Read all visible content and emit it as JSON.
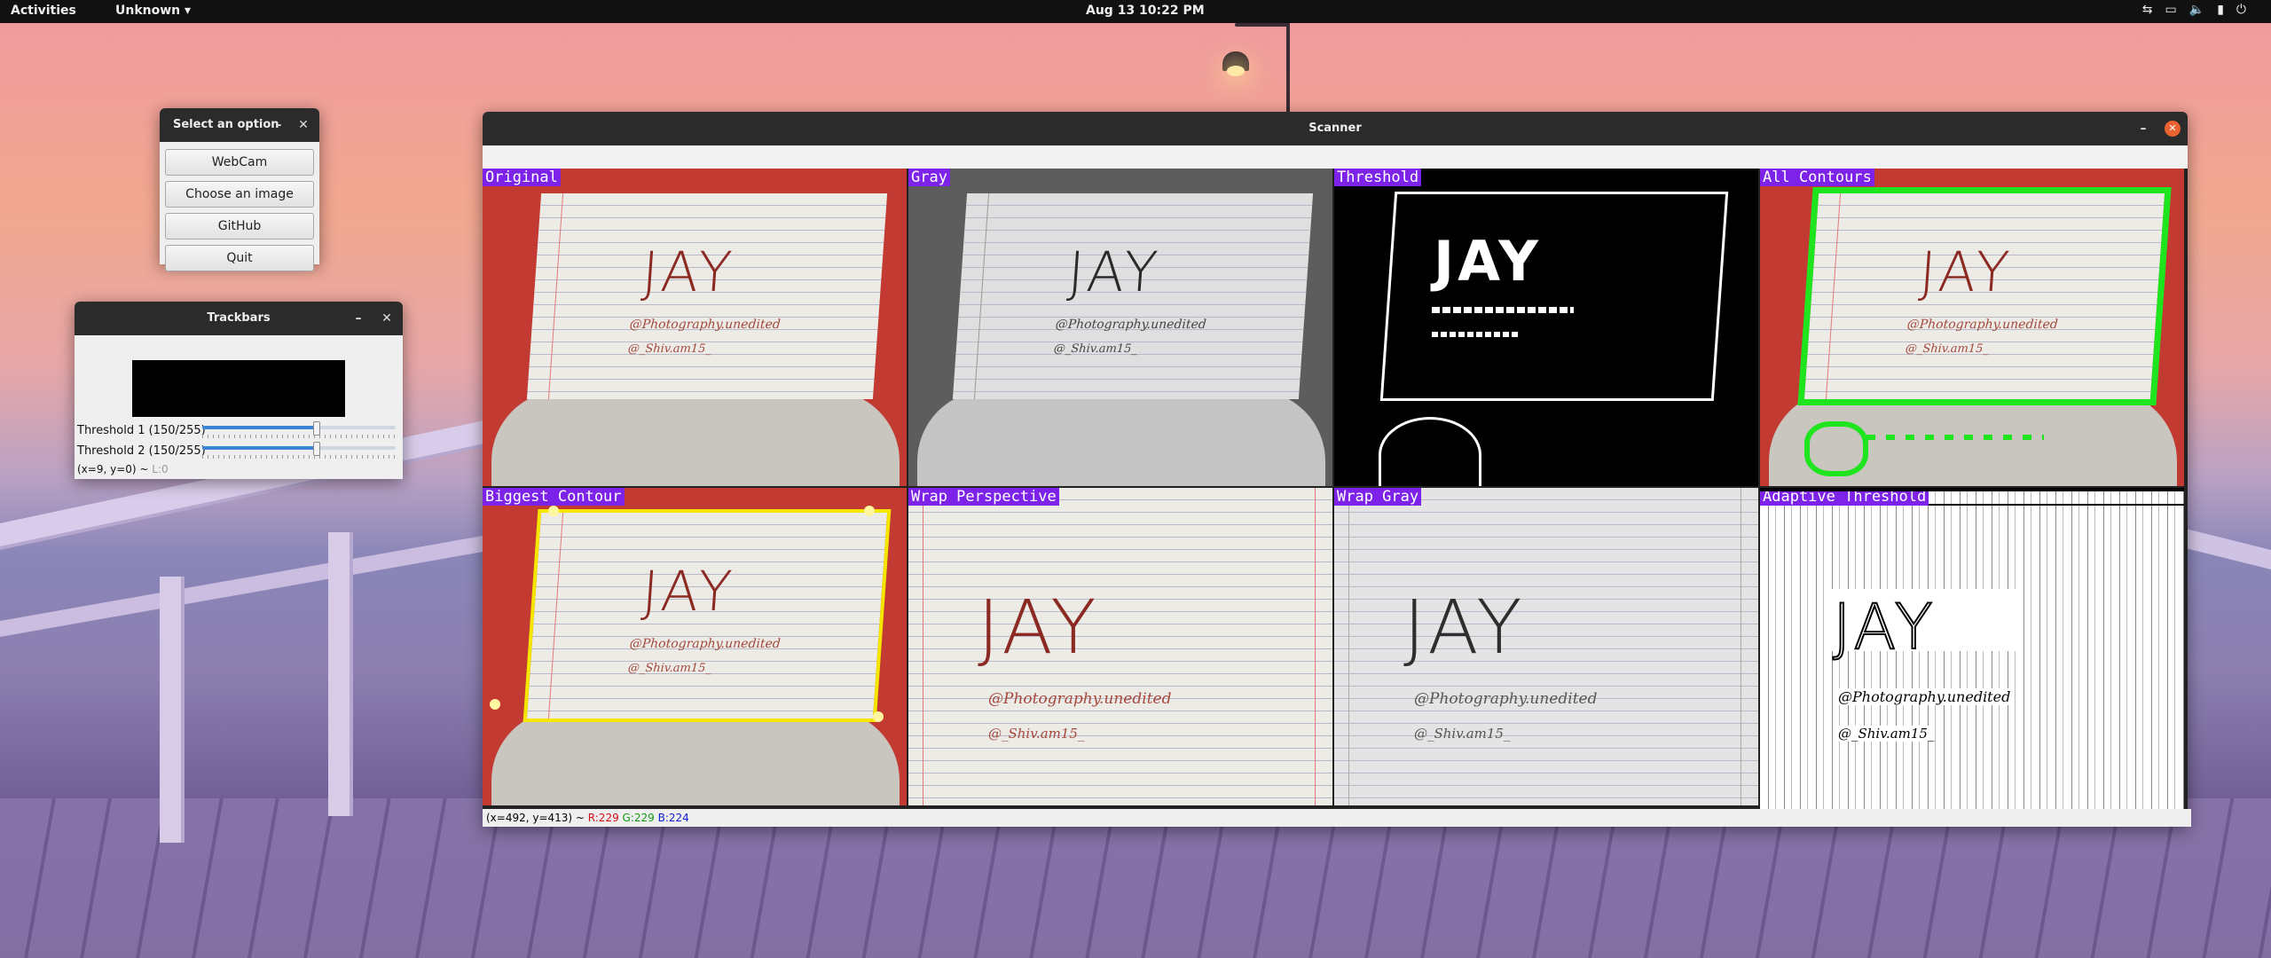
{
  "topbar": {
    "activities": "Activities",
    "app_menu": "Unknown ▾",
    "clock": "Aug 13  10:22 PM"
  },
  "option_window": {
    "title": "Select an option",
    "buttons": [
      "WebCam",
      "Choose an image",
      "GitHub",
      "Quit"
    ]
  },
  "trackbars_window": {
    "title": "Trackbars",
    "threshold1_label": "Threshold 1 (150/255)",
    "threshold2_label": "Threshold 2 (150/255)",
    "threshold1_value": 150,
    "threshold2_value": 150,
    "max": 255,
    "status": "(x=9, y=0) ~ ",
    "status_l": "L:0"
  },
  "scanner_window": {
    "title": "Scanner",
    "panels": [
      {
        "label": "Original"
      },
      {
        "label": "Gray"
      },
      {
        "label": "Threshold"
      },
      {
        "label": "All Contours"
      },
      {
        "label": "Biggest Contour"
      },
      {
        "label": "Wrap Perspective"
      },
      {
        "label": "Wrap Gray"
      },
      {
        "label": "Adaptive Threshold"
      }
    ],
    "paper_text": "JAY",
    "paper_line1": "@Photography.unedited",
    "paper_line2": "@_Shiv.am15_",
    "status_coords": "(x=492, y=413) ~ ",
    "status_r": "R:229",
    "status_g": "G:229",
    "status_b": "B:224"
  },
  "colors": {
    "label_bg": "#7d22e8",
    "contour_green": "#1ee51e",
    "contour_yellow": "#f5e600"
  }
}
